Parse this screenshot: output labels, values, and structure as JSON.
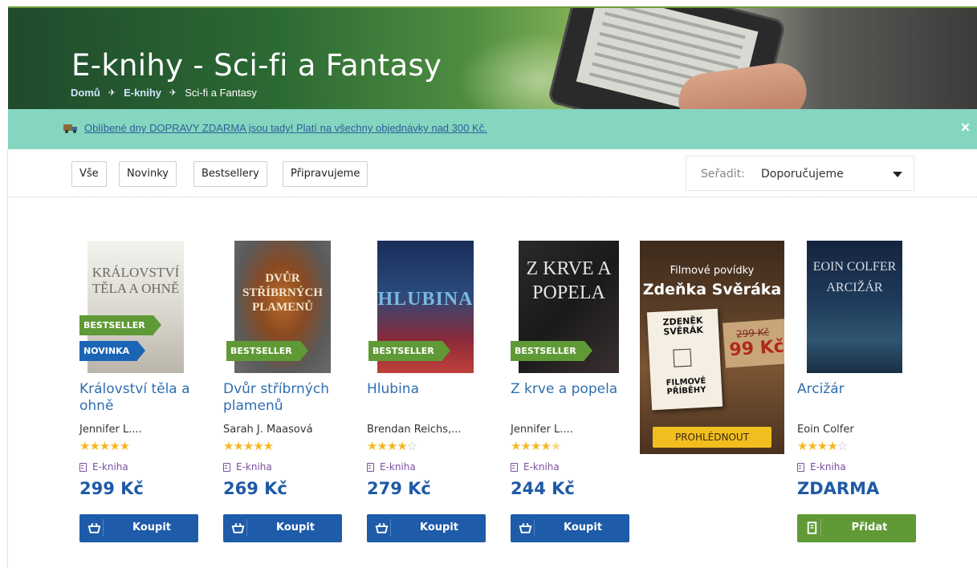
{
  "hero": {
    "title": "E-knihy - Sci-fi a Fantasy",
    "breadcrumb": [
      "Domů",
      "E-knihy",
      "Sci-fi a Fantasy"
    ]
  },
  "promo": {
    "text": "Oblíbené dny DOPRAVY ZDARMA jsou tady! Platí na všechny objednávky nad 300 Kč.",
    "close_icon": "×"
  },
  "filters": [
    "Vše",
    "Novinky",
    "Bestsellery",
    "Připravujeme"
  ],
  "sort": {
    "label": "Seřadit:",
    "value": "Doporučujeme"
  },
  "products": [
    {
      "title": "Království těla a ohně",
      "author": "Jennifer L....",
      "rating": 5,
      "format": "E-kniha",
      "price": "299 Kč",
      "button": "Koupit",
      "badges": [
        "BESTSELLER",
        "NOVINKA"
      ],
      "cover": {
        "text": "KRÁLOVSTVÍ TĚLA A OHNĚ",
        "colors": [
          "#eaeae6",
          "#c9c6bd"
        ]
      }
    },
    {
      "title": "Dvůr stříbrných plamenů",
      "author": "Sarah J. Maasová",
      "rating": 5,
      "format": "E-kniha",
      "price": "269 Kč",
      "button": "Koupit",
      "badges": [
        "BESTSELLER"
      ],
      "cover": {
        "text": "DVŮR STŘÍBRNÝCH PLAMENŮ",
        "colors": [
          "#5a5a5a",
          "#8a4a22"
        ]
      }
    },
    {
      "title": "Hlubina",
      "author": "Brendan Reichs,...",
      "rating": 4,
      "format": "E-kniha",
      "price": "279 Kč",
      "button": "Koupit",
      "badges": [
        "BESTSELLER"
      ],
      "cover": {
        "text": "HLUBINA",
        "colors": [
          "#1a2d5a",
          "#b0353f"
        ]
      }
    },
    {
      "title": "Z krve a popela",
      "author": "Jennifer L....",
      "rating": 4.5,
      "format": "E-kniha",
      "price": "244 Kč",
      "button": "Koupit",
      "badges": [
        "BESTSELLER"
      ],
      "cover": {
        "text": "Z KRVE A POPELA",
        "colors": [
          "#1c1c1c",
          "#3a3a3a"
        ]
      }
    },
    {
      "title": "Arcižár",
      "author": "Eoin Colfer",
      "rating": 4,
      "format": "E-kniha",
      "price": "ZDARMA",
      "button": "Přidat",
      "badges": [],
      "cover": {
        "text": "EOIN COLFER ARCIŽÁR",
        "colors": [
          "#1a2f4a",
          "#3a5a72"
        ]
      }
    }
  ],
  "ad": {
    "line1": "Filmové povídky",
    "line2": "Zdeňka Svěráka",
    "book_author": "ZDENĚK SVĚRÁK",
    "book_title": "FILMOVÉ PŘÍBĚHY",
    "old_price": "299 Kč",
    "new_price": "99 Kč",
    "button": "PROHLÉDNOUT"
  },
  "colors": {
    "accent": "#1e5ba8",
    "green": "#5f9a36",
    "promo_bg": "#84d6c0",
    "link": "#2f6fae"
  },
  "icons": [
    "truck-icon",
    "close-icon",
    "caret-down-icon",
    "book-icon",
    "basket-icon",
    "star-icon"
  ]
}
